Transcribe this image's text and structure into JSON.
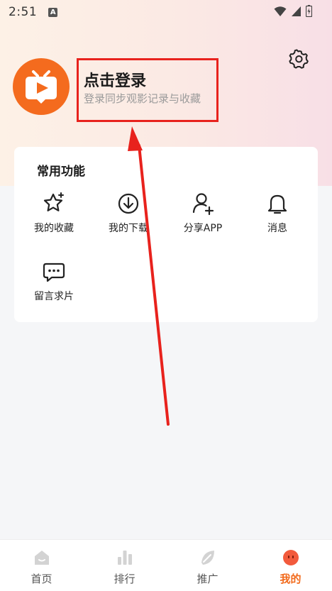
{
  "status_bar": {
    "time": "2:51",
    "notification_letter": "A"
  },
  "profile": {
    "login_title": "点击登录",
    "login_subtitle": "登录同步观影记录与收藏"
  },
  "functions": {
    "title": "常用功能",
    "items": [
      {
        "label": "我的收藏",
        "icon": "star-icon"
      },
      {
        "label": "我的下载",
        "icon": "download-icon"
      },
      {
        "label": "分享APP",
        "icon": "add-user-icon"
      },
      {
        "label": "消息",
        "icon": "bell-icon"
      },
      {
        "label": "留言求片",
        "icon": "chat-bubble-icon"
      }
    ]
  },
  "tabbar": {
    "tabs": [
      {
        "label": "首页",
        "icon": "home-icon"
      },
      {
        "label": "排行",
        "icon": "ranking-icon"
      },
      {
        "label": "推广",
        "icon": "promote-icon"
      },
      {
        "label": "我的",
        "icon": "profile-face-icon"
      }
    ],
    "active_index": 3
  },
  "colors": {
    "accent": "#f26a1b",
    "highlight_red": "#e8221d"
  }
}
